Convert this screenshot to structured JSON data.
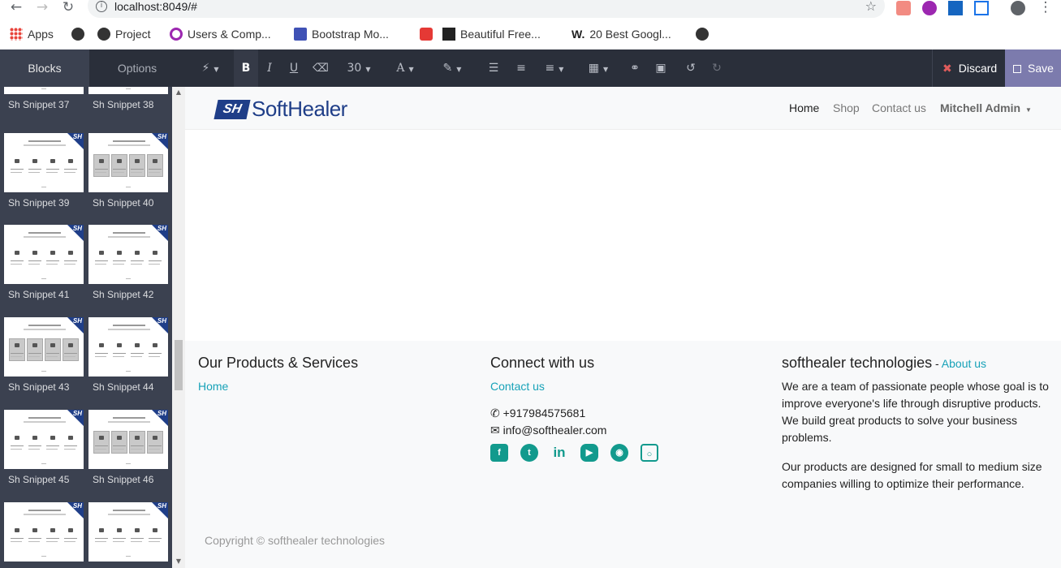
{
  "browser": {
    "url": "localhost:8049/#",
    "bookmarks": [
      {
        "label": "Apps",
        "color": "#e8453c"
      },
      {
        "label": "",
        "color": "#333333"
      },
      {
        "label": "Project",
        "color": "#333333"
      },
      {
        "label": "Users & Comp...",
        "color": "#9c27b0"
      },
      {
        "label": "Bootstrap Mo...",
        "color": "#3f51b5"
      },
      {
        "label": "Beautiful Free...",
        "color": "#e53935"
      },
      {
        "label": "20 Best Googl...",
        "color": "#222222"
      },
      {
        "label": "",
        "color": "#333333"
      }
    ]
  },
  "editor": {
    "tabs": {
      "blocks": "Blocks",
      "options": "Options"
    },
    "toolbar": {
      "font_size": "30",
      "discard": "Discard",
      "save": "Save"
    }
  },
  "sidebar": {
    "snippets": [
      {
        "label": "Sh Snippet 37"
      },
      {
        "label": "Sh Snippet 38"
      },
      {
        "label": "Sh Snippet 39"
      },
      {
        "label": "Sh Snippet 40"
      },
      {
        "label": "Sh Snippet 41"
      },
      {
        "label": "Sh Snippet 42"
      },
      {
        "label": "Sh Snippet 43"
      },
      {
        "label": "Sh Snippet 44"
      },
      {
        "label": "Sh Snippet 45"
      },
      {
        "label": "Sh Snippet 46"
      },
      {
        "label": ""
      },
      {
        "label": ""
      }
    ]
  },
  "site": {
    "logo": {
      "mark": "SH",
      "text": "SoftHealer"
    },
    "nav": {
      "home": "Home",
      "shop": "Shop",
      "contact": "Contact us",
      "user": "Mitchell Admin"
    },
    "footer": {
      "col1": {
        "title": "Our Products & Services",
        "link": "Home"
      },
      "col2": {
        "title": "Connect with us",
        "link": "Contact us",
        "phone": "+917984575681",
        "email": "info@softhealer.com"
      },
      "col3": {
        "title": "softhealer technologies",
        "about_link": "About us",
        "p1": "We are a team of passionate people whose goal is to improve everyone's life through disruptive products. We build great products to solve your business problems.",
        "p2": "Our products are designed for small to medium size companies willing to optimize their performance."
      },
      "copyright": "Copyright © softhealer technologies"
    }
  },
  "colors": {
    "accent": "#17a2b8",
    "brand": "#1f3e88",
    "save": "#7c7bad"
  }
}
